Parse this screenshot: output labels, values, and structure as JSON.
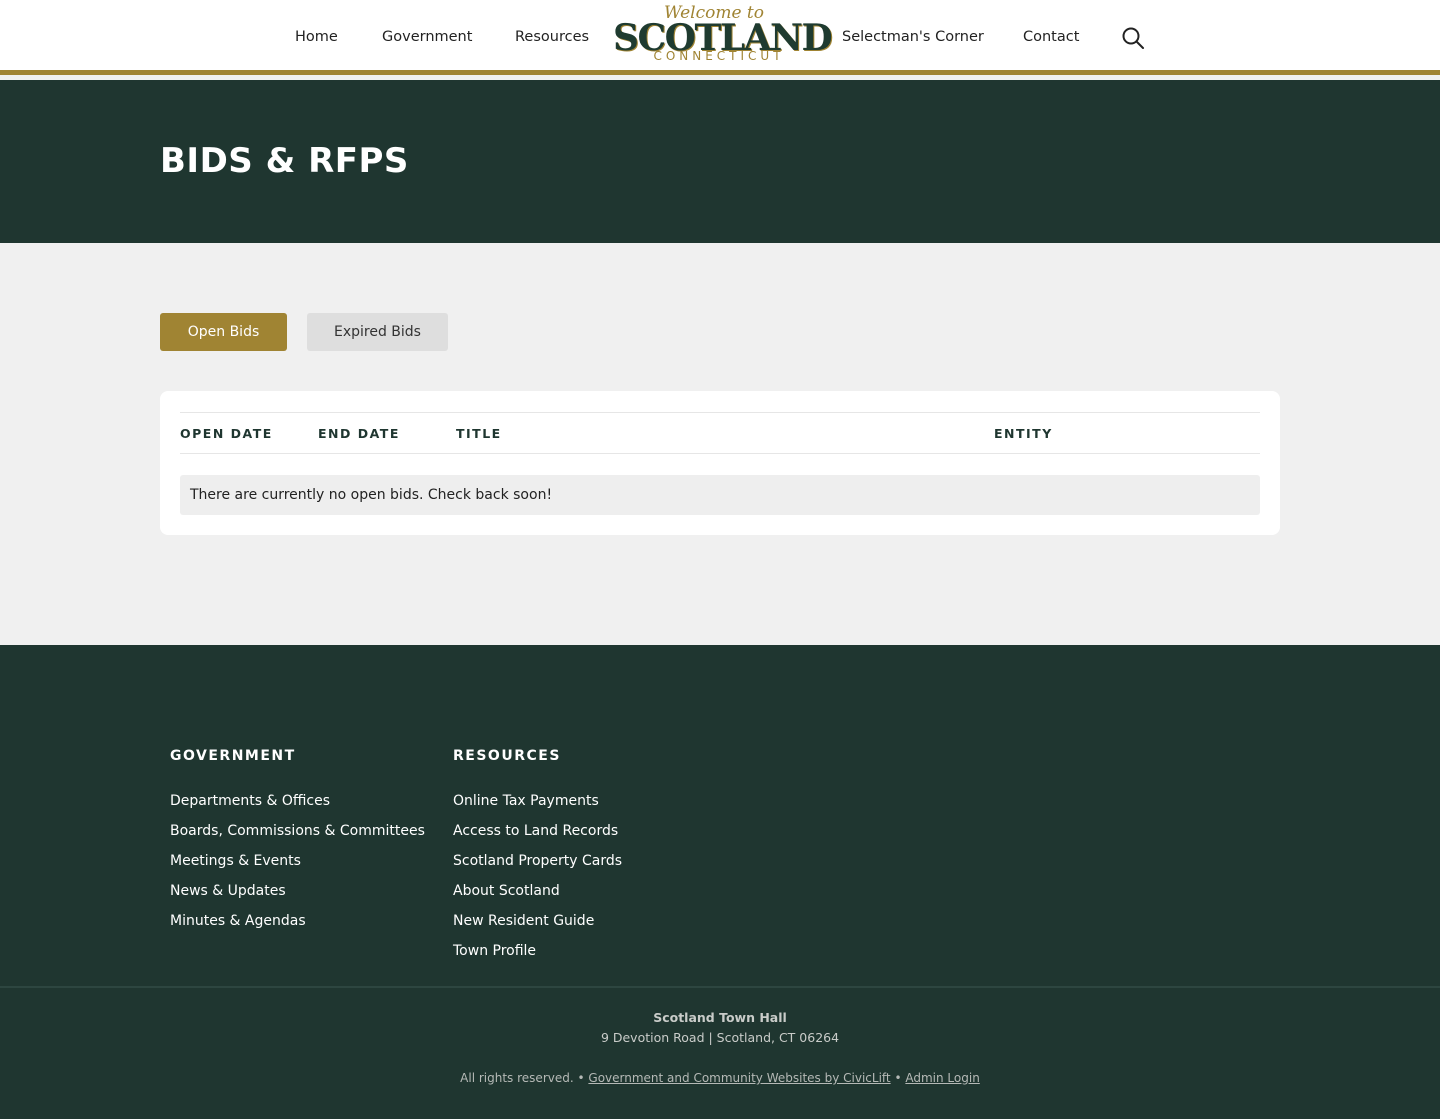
{
  "header": {
    "nav": [
      "Home",
      "Government",
      "Resources",
      "Selectman's Corner",
      "Contact"
    ],
    "logo": {
      "line1": "Welcome to",
      "line2": "SCOTLAND",
      "line3": "CONNECTICUT"
    },
    "search_icon": "search-icon"
  },
  "hero": {
    "title": "BIDS & RFPS"
  },
  "tabs": {
    "open": "Open Bids",
    "expired": "Expired Bids"
  },
  "table": {
    "columns": [
      "OPEN DATE",
      "END DATE",
      "TITLE",
      "ENTITY"
    ],
    "empty_message": "There are currently no open bids. Check back soon!"
  },
  "footer": {
    "government": {
      "heading": "GOVERNMENT",
      "links": [
        "Departments & Offices",
        "Boards, Commissions & Committees",
        "Meetings & Events",
        "News & Updates",
        "Minutes & Agendas"
      ]
    },
    "resources": {
      "heading": "RESOURCES",
      "links": [
        "Online Tax Payments",
        "Access to Land Records",
        "Scotland Property Cards",
        "About Scotland",
        "New Resident Guide",
        "Town Profile"
      ]
    },
    "hall_name": "Scotland Town Hall",
    "address": "9 Devotion Road | Scotland, CT  06264",
    "rights": "All rights reserved.",
    "sep": "•",
    "credit": "Government and Community Websites by CivicLift",
    "admin": "Admin Login"
  },
  "colors": {
    "brand_green": "#1f3630",
    "gold": "#a08433"
  }
}
